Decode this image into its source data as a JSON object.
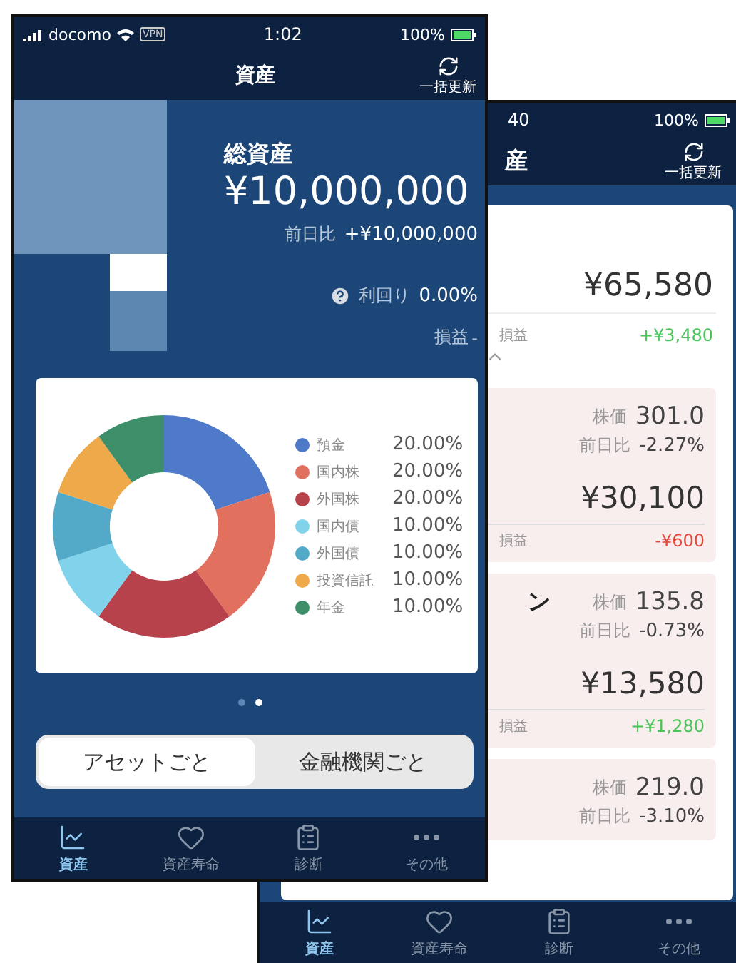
{
  "front_phone": {
    "status_bar": {
      "carrier": "docomo",
      "vpn": "VPN",
      "time": "1:02",
      "battery": "100%"
    },
    "header": {
      "title": "資産",
      "action": "一括更新"
    },
    "summary": {
      "label": "総資産",
      "total": "¥10,000,000",
      "change_label": "前日比",
      "change": "+¥10,000,000",
      "yield_label": "利回り",
      "yield": "0.00%",
      "profit_label": "損益",
      "profit": "-"
    },
    "chart_card": {
      "chart_data": {
        "type": "donut",
        "categories": [
          "預金",
          "国内株",
          "外国株",
          "国内債",
          "外国債",
          "投資信託",
          "年金"
        ],
        "series": [
          {
            "values": [
              20,
              20,
              20,
              10,
              10,
              10,
              10
            ]
          }
        ],
        "value_labels": [
          "20.00%",
          "20.00%",
          "20.00%",
          "10.00%",
          "10.00%",
          "10.00%",
          "10.00%"
        ]
      },
      "legend": [
        {
          "color": "#4f79c9"
        },
        {
          "color": "#e2705f"
        },
        {
          "color": "#b8424b"
        },
        {
          "color": "#80d3ea"
        },
        {
          "color": "#52aac8"
        },
        {
          "color": "#eda94a"
        },
        {
          "color": "#3d8f69"
        }
      ]
    },
    "pager": [
      {
        "selected": false
      },
      {
        "selected": true
      }
    ],
    "segments": [
      {
        "label": "アセットごと",
        "selected": true
      },
      {
        "label": "金融機関ごと",
        "selected": false
      }
    ],
    "tab_bar": [
      {
        "label": "資産",
        "kind": "chart",
        "selected": true
      },
      {
        "label": "資産寿命",
        "kind": "heart",
        "selected": false
      },
      {
        "label": "診断",
        "kind": "clipboard",
        "selected": false
      },
      {
        "label": "その他",
        "kind": "more",
        "selected": false
      }
    ]
  },
  "back_phone": {
    "status_bar": {
      "time": "40",
      "battery": "100%"
    },
    "header": {
      "title": "産",
      "action": "一括更新"
    },
    "total_card": {
      "total": "¥65,580",
      "profit_label": "損益",
      "profit": "+¥3,480",
      "positive": true
    },
    "holdings": [
      {
        "price_label": "株価",
        "price": "301.0",
        "change_label": "前日比",
        "change": "-2.27%",
        "value": "¥30,100",
        "profit_label": "損益",
        "profit": "-¥600",
        "positive": false
      },
      {
        "name": "ン",
        "price_label": "株価",
        "price": "135.8",
        "change_label": "前日比",
        "change": "-0.73%",
        "value": "¥13,580",
        "profit_label": "損益",
        "profit": "+¥1,280",
        "positive": true
      },
      {
        "price_label": "株価",
        "price": "219.0",
        "change_label": "前日比",
        "change": "-3.10%"
      }
    ],
    "tab_bar": [
      {
        "label": "資産",
        "kind": "chart",
        "selected": true
      },
      {
        "label": "資産寿命",
        "kind": "heart",
        "selected": false
      },
      {
        "label": "診断",
        "kind": "clipboard",
        "selected": false
      },
      {
        "label": "その他",
        "kind": "more",
        "selected": false
      }
    ]
  }
}
